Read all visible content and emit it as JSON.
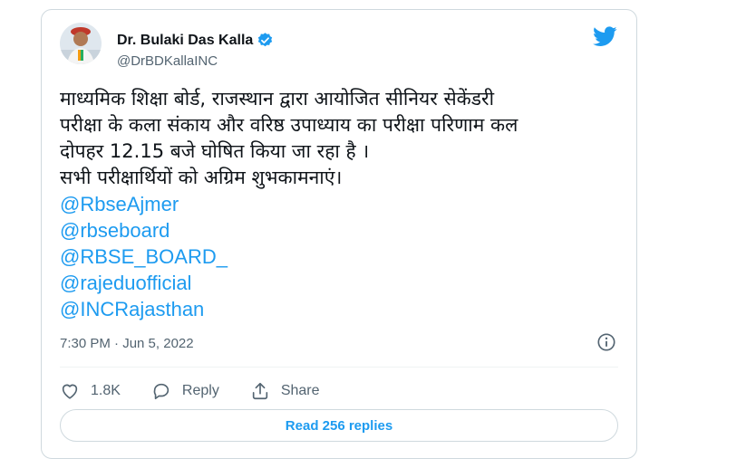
{
  "tweet": {
    "author": {
      "display_name": "Dr. Bulaki Das Kalla",
      "handle": "@DrBDKallaINC",
      "verified": true,
      "avatar_icon": "profile-photo"
    },
    "lines": [
      "माध्यमिक शिक्षा बोर्ड, राजस्थान द्वारा आयोजित सीनियर सेकेंडरी",
      "परीक्षा के कला संकाय और वरिष्ठ उपाध्याय का परीक्षा परिणाम कल",
      "दोपहर 12.15 बजे घोषित किया जा रहा है ।",
      "सभी परीक्षार्थियों को अग्रिम शुभकामनाएं।"
    ],
    "mentions": [
      "@RbseAjmer",
      "@rbseboard",
      "@RBSE_BOARD_",
      "@rajeduofficial",
      "@INCRajasthan"
    ],
    "timestamp": "7:30 PM · Jun 5, 2022",
    "actions": {
      "like_count": "1.8K",
      "reply_label": "Reply",
      "share_label": "Share"
    },
    "read_replies_label": "Read 256 replies"
  },
  "colors": {
    "accent": "#1d9bf0",
    "text": "#0f1419",
    "muted": "#536471",
    "border": "#cfd9de"
  },
  "icons": [
    "twitter-bird-icon",
    "verified-badge-icon",
    "info-icon",
    "heart-icon",
    "reply-icon",
    "share-icon"
  ]
}
